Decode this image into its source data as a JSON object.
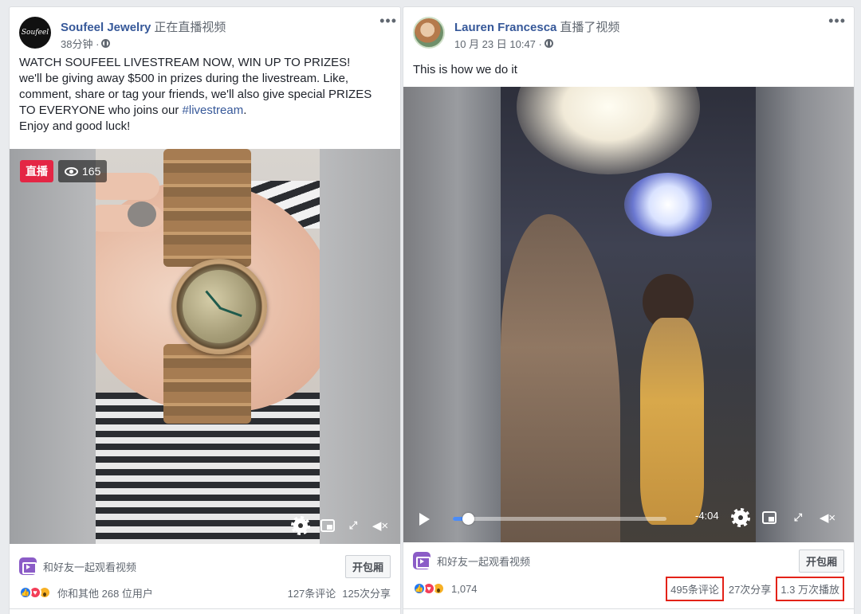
{
  "left_post": {
    "author": "Soufeel Jewelry",
    "action": "正在直播视频",
    "time": "38分钟 ·",
    "avatar_text": "Soufeel",
    "text_lines": [
      "WATCH SOUFEEL LIVESTREAM NOW, WIN UP TO PRIZES!",
      "we'll be giving away $500 in prizes during the livestream. Like,",
      "comment, share or tag your friends, we'll also give special PRIZES"
    ],
    "text_line4_prefix": "TO EVERYONE who joins our ",
    "hashtag": "#livestream",
    "text_line4_suffix": ".",
    "text_line5": "Enjoy and good luck!",
    "live_label": "直播",
    "viewers": "165",
    "watch_party_label": "和好友一起观看视频",
    "open_room_label": "开包厢",
    "reactions_text": "你和其他 268 位用户",
    "comments": "127条评论",
    "shares": "125次分享"
  },
  "right_post": {
    "author": "Lauren Francesca",
    "action": "直播了视频",
    "time": "10 月 23 日 10:47 ·",
    "text": "This is how we do it",
    "time_remaining": "-4:04",
    "progress_fraction": 0.07,
    "watch_party_label": "和好友一起观看视频",
    "open_room_label": "开包厢",
    "reactions_count": "1,074",
    "comments": "495条评论",
    "shares": "27次分享",
    "views": "1.3 万次播放"
  },
  "colors": {
    "link_blue": "#365899",
    "live_red": "#e42645",
    "highlight_red": "#e32218",
    "progress_blue": "#4b8cf7"
  },
  "icons": [
    "more-icon",
    "globe-icon",
    "eye-icon",
    "gear-icon",
    "pip-icon",
    "expand-icon",
    "mute-icon",
    "play-icon",
    "party-icon",
    "like-icon",
    "love-icon",
    "wow-icon"
  ]
}
